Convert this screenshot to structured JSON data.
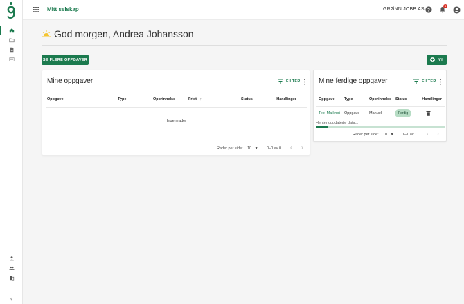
{
  "app": {
    "title": "Mitt selskap",
    "company": "GRØNN JOBB AS",
    "notifications_count": "1"
  },
  "sidebar": {
    "top_items": [
      {
        "icon": "home-icon",
        "active": true
      },
      {
        "icon": "folder-icon",
        "active": false
      },
      {
        "icon": "document-icon",
        "active": false
      },
      {
        "icon": "list-icon",
        "active": false
      }
    ],
    "bottom_items": [
      {
        "icon": "person-icon"
      },
      {
        "icon": "people-icon"
      },
      {
        "icon": "building-icon"
      }
    ],
    "collapse_label": "‹"
  },
  "greeting": {
    "icon": "sunrise-icon",
    "text": "God morgen, Andrea Johansson"
  },
  "actions": {
    "see_more_tasks": "SE FLERE OPPGAVER",
    "new": "NY"
  },
  "my_tasks": {
    "title": "Mine oppgaver",
    "filter": "FILTER",
    "columns": [
      "Oppgave",
      "Type",
      "Opprinnelse",
      "Frist",
      "Status",
      "Handlinger"
    ],
    "sort_indicator": "↑",
    "empty": "Ingen rader",
    "rows_per_page_label": "Rader per side:",
    "rows_per_page": "10",
    "range": "0–0 av 0"
  },
  "done_tasks": {
    "title": "Mine ferdige oppgaver",
    "filter": "FILTER",
    "columns": [
      "Oppgave",
      "Type",
      "Opprinnelse",
      "Status",
      "Handlinger"
    ],
    "rows": [
      {
        "task": "Test Mail not",
        "type": "Oppgave",
        "origin": "Manuell",
        "status": "Ferdig"
      }
    ],
    "loading": "Henter oppdaterte data...",
    "rows_per_page_label": "Rader per side:",
    "rows_per_page": "10",
    "range": "1–1 av 1"
  },
  "colors": {
    "accent": "#1b7a4e",
    "chip": "#b6dcc4",
    "badge": "#d93025"
  }
}
